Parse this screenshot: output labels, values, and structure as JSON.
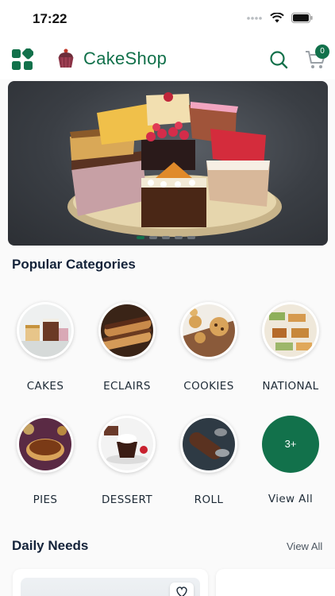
{
  "status_bar": {
    "time": "17:22"
  },
  "header": {
    "brand": "CakeShop",
    "cart_count": "0"
  },
  "banner": {
    "slides": 5,
    "active_slide": 1
  },
  "popular_categories": {
    "title": "Popular Categories",
    "items": [
      {
        "label": "CAKES",
        "icon": "cakes-image"
      },
      {
        "label": "ECLAIRS",
        "icon": "eclairs-image"
      },
      {
        "label": "COOKIES",
        "icon": "cookies-image"
      },
      {
        "label": "NATIONAL",
        "icon": "national-image"
      },
      {
        "label": "PIES",
        "icon": "pies-image"
      },
      {
        "label": "DESSERT",
        "icon": "dessert-image"
      },
      {
        "label": "ROLL",
        "icon": "roll-image"
      }
    ],
    "view_all": {
      "count_label": "3+",
      "label": "View All"
    }
  },
  "daily_needs": {
    "title": "Daily Needs",
    "view_all": "View All"
  },
  "colors": {
    "brand": "#12714b",
    "text": "#14233a"
  }
}
